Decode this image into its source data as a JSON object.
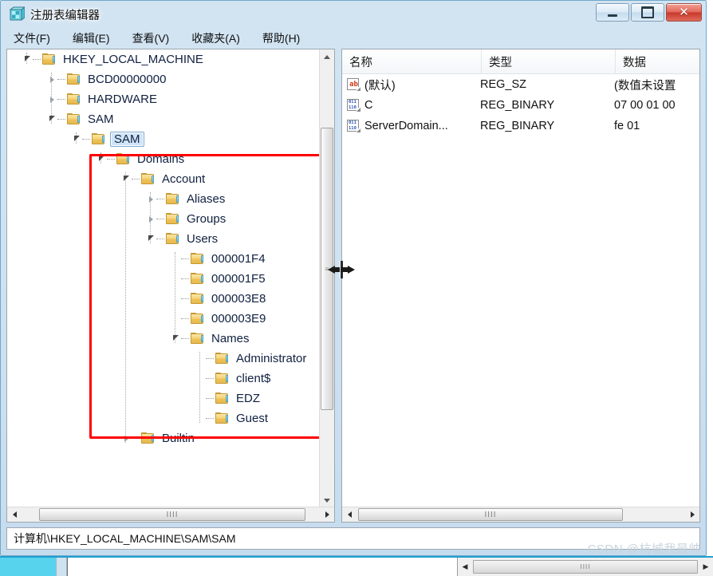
{
  "window": {
    "title": "注册表编辑器",
    "app_icon": "registry-editor-icon",
    "controls": {
      "minimize": "最小化",
      "maximize": "最大化",
      "close": "关闭",
      "close_glyph": "✕"
    }
  },
  "menubar": {
    "items": [
      {
        "label": "文件(F)"
      },
      {
        "label": "编辑(E)"
      },
      {
        "label": "查看(V)"
      },
      {
        "label": "收藏夹(A)"
      },
      {
        "label": "帮助(H)"
      }
    ]
  },
  "tree": {
    "nodes": [
      {
        "label": "HKEY_LOCAL_MACHINE",
        "depth": 0,
        "state": "expanded",
        "selected": false
      },
      {
        "label": "BCD00000000",
        "depth": 1,
        "state": "collapsed",
        "selected": false
      },
      {
        "label": "HARDWARE",
        "depth": 1,
        "state": "collapsed",
        "selected": false
      },
      {
        "label": "SAM",
        "depth": 1,
        "state": "expanded",
        "selected": false
      },
      {
        "label": "SAM",
        "depth": 2,
        "state": "expanded",
        "selected": true
      },
      {
        "label": "Domains",
        "depth": 3,
        "state": "expanded",
        "selected": false
      },
      {
        "label": "Account",
        "depth": 4,
        "state": "expanded",
        "selected": false
      },
      {
        "label": "Aliases",
        "depth": 5,
        "state": "collapsed",
        "selected": false
      },
      {
        "label": "Groups",
        "depth": 5,
        "state": "collapsed",
        "selected": false
      },
      {
        "label": "Users",
        "depth": 5,
        "state": "expanded",
        "selected": false
      },
      {
        "label": "000001F4",
        "depth": 6,
        "state": "leaf",
        "selected": false
      },
      {
        "label": "000001F5",
        "depth": 6,
        "state": "leaf",
        "selected": false
      },
      {
        "label": "000003E8",
        "depth": 6,
        "state": "leaf",
        "selected": false
      },
      {
        "label": "000003E9",
        "depth": 6,
        "state": "leaf",
        "selected": false
      },
      {
        "label": "Names",
        "depth": 6,
        "state": "expanded",
        "selected": false
      },
      {
        "label": "Administrator",
        "depth": 7,
        "state": "leaf",
        "selected": false
      },
      {
        "label": "client$",
        "depth": 7,
        "state": "leaf",
        "selected": false
      },
      {
        "label": "EDZ",
        "depth": 7,
        "state": "leaf",
        "selected": false
      },
      {
        "label": "Guest",
        "depth": 7,
        "state": "leaf",
        "selected": false
      },
      {
        "label": "Builtin",
        "depth": 4,
        "state": "collapsed",
        "selected": false
      }
    ]
  },
  "annotation": {
    "shape": "rectangle",
    "color": "#fe0000",
    "covers": "Domains subtree through Guest"
  },
  "list": {
    "columns": [
      {
        "label": "名称"
      },
      {
        "label": "类型"
      },
      {
        "label": "数据"
      }
    ],
    "rows": [
      {
        "name": "(默认)",
        "type": "REG_SZ",
        "data": "(数值未设置",
        "icon": "string-value-icon"
      },
      {
        "name": "C",
        "type": "REG_BINARY",
        "data": "07 00 01 00",
        "icon": "binary-value-icon"
      },
      {
        "name": "ServerDomain...",
        "type": "REG_BINARY",
        "data": "fe 01",
        "icon": "binary-value-icon"
      }
    ]
  },
  "statusbar": {
    "path": "计算机\\HKEY_LOCAL_MACHINE\\SAM\\SAM"
  },
  "watermark": {
    "text": "CSDN @杭城我最帅"
  },
  "scrollbars": {
    "tree_vertical_grip": "≡",
    "tree_horizontal_grip": "IIII",
    "list_horizontal_grip": "IIII",
    "background_horizontal_grip": "IIII"
  },
  "cursor": {
    "type": "column-resize-cursor"
  }
}
